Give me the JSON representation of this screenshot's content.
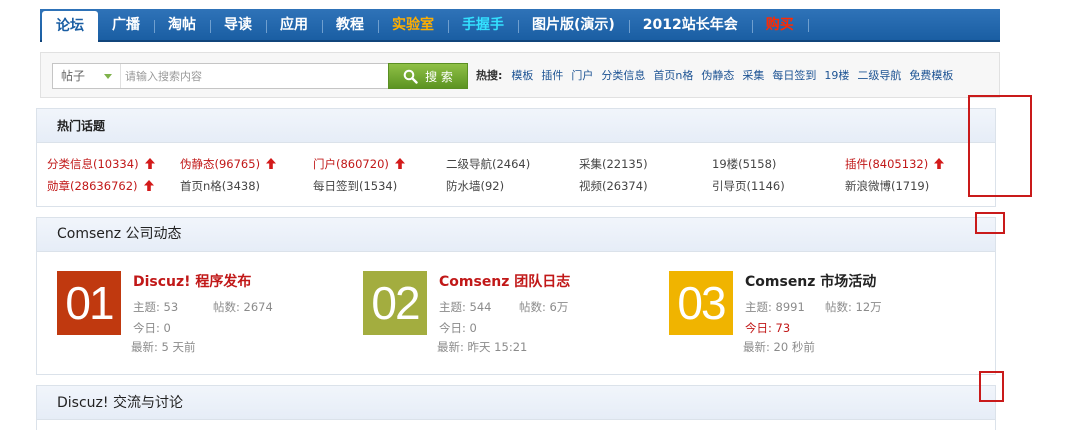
{
  "nav": {
    "items": [
      {
        "label": "论坛",
        "active": true
      },
      {
        "label": "广播"
      },
      {
        "label": "淘帖"
      },
      {
        "label": "导读"
      },
      {
        "label": "应用"
      },
      {
        "label": "教程"
      },
      {
        "label": "实验室",
        "color": "orange"
      },
      {
        "label": "手握手",
        "color": "cyan"
      },
      {
        "label": "图片版(演示)"
      },
      {
        "label": "2012站长年会"
      },
      {
        "label": "购买",
        "color": "red"
      }
    ]
  },
  "search": {
    "type_label": "帖子",
    "placeholder": "请输入搜索内容",
    "button_label": "搜 索"
  },
  "hotwords": {
    "label": "热搜:",
    "items": [
      "模板",
      "插件",
      "门户",
      "分类信息",
      "首页n格",
      "伪静态",
      "采集",
      "每日签到",
      "19楼",
      "二级导航",
      "免费模板"
    ]
  },
  "hot_topics": {
    "title": "热门话题",
    "items": [
      {
        "text": "分类信息(10334)",
        "hot": true
      },
      {
        "text": "伪静态(96765)",
        "hot": true
      },
      {
        "text": "门户(860720)",
        "hot": true
      },
      {
        "text": "二级导航(2464)",
        "hot": false
      },
      {
        "text": "采集(22135)",
        "hot": false
      },
      {
        "text": "19楼(5158)",
        "hot": false
      },
      {
        "text": "插件(8405132)",
        "hot": true
      },
      {
        "text": "勋章(28636762)",
        "hot": true
      },
      {
        "text": "首页n格(3438)",
        "hot": false
      },
      {
        "text": "每日签到(1534)",
        "hot": false
      },
      {
        "text": "防水墙(92)",
        "hot": false
      },
      {
        "text": "视频(26374)",
        "hot": false
      },
      {
        "text": "引导页(1146)",
        "hot": false
      },
      {
        "text": "新浪微博(1719)",
        "hot": false
      }
    ]
  },
  "news": {
    "title": "Comsenz 公司动态",
    "items": [
      {
        "badge": "01",
        "badge_color": "#c0390f",
        "title": "Discuz! 程序发布",
        "title_color": "#c11818",
        "topics_label": "主题:",
        "topics": "53",
        "posts_label": "帖数:",
        "posts": "2674",
        "today_label": "今日:",
        "today": "0",
        "today_hot": false,
        "latest_label": "最新:",
        "latest": "5 天前"
      },
      {
        "badge": "02",
        "badge_color": "#a3ad3f",
        "title": "Comsenz 团队日志",
        "title_color": "#c11818",
        "topics_label": "主题:",
        "topics": "544",
        "posts_label": "帖数:",
        "posts": "6万",
        "today_label": "今日:",
        "today": "0",
        "today_hot": false,
        "latest_label": "最新:",
        "latest": "昨天 15:21"
      },
      {
        "badge": "03",
        "badge_color": "#f0b400",
        "title": "Comsenz 市场活动",
        "title_color": "#222222",
        "topics_label": "主题:",
        "topics": "8991",
        "posts_label": "帖数:",
        "posts": "12万",
        "today_label": "今日:",
        "today": "73",
        "today_hot": true,
        "latest_label": "最新:",
        "latest": "20 秒前"
      }
    ]
  },
  "discuss": {
    "title": "Discuz! 交流与讨论"
  },
  "colors": {
    "nav_blue": "#1a5ea3",
    "accent_red": "#c11818",
    "search_green": "#6ba22c",
    "link_blue": "#1e5494",
    "annotation_red": "#c91a1a"
  }
}
